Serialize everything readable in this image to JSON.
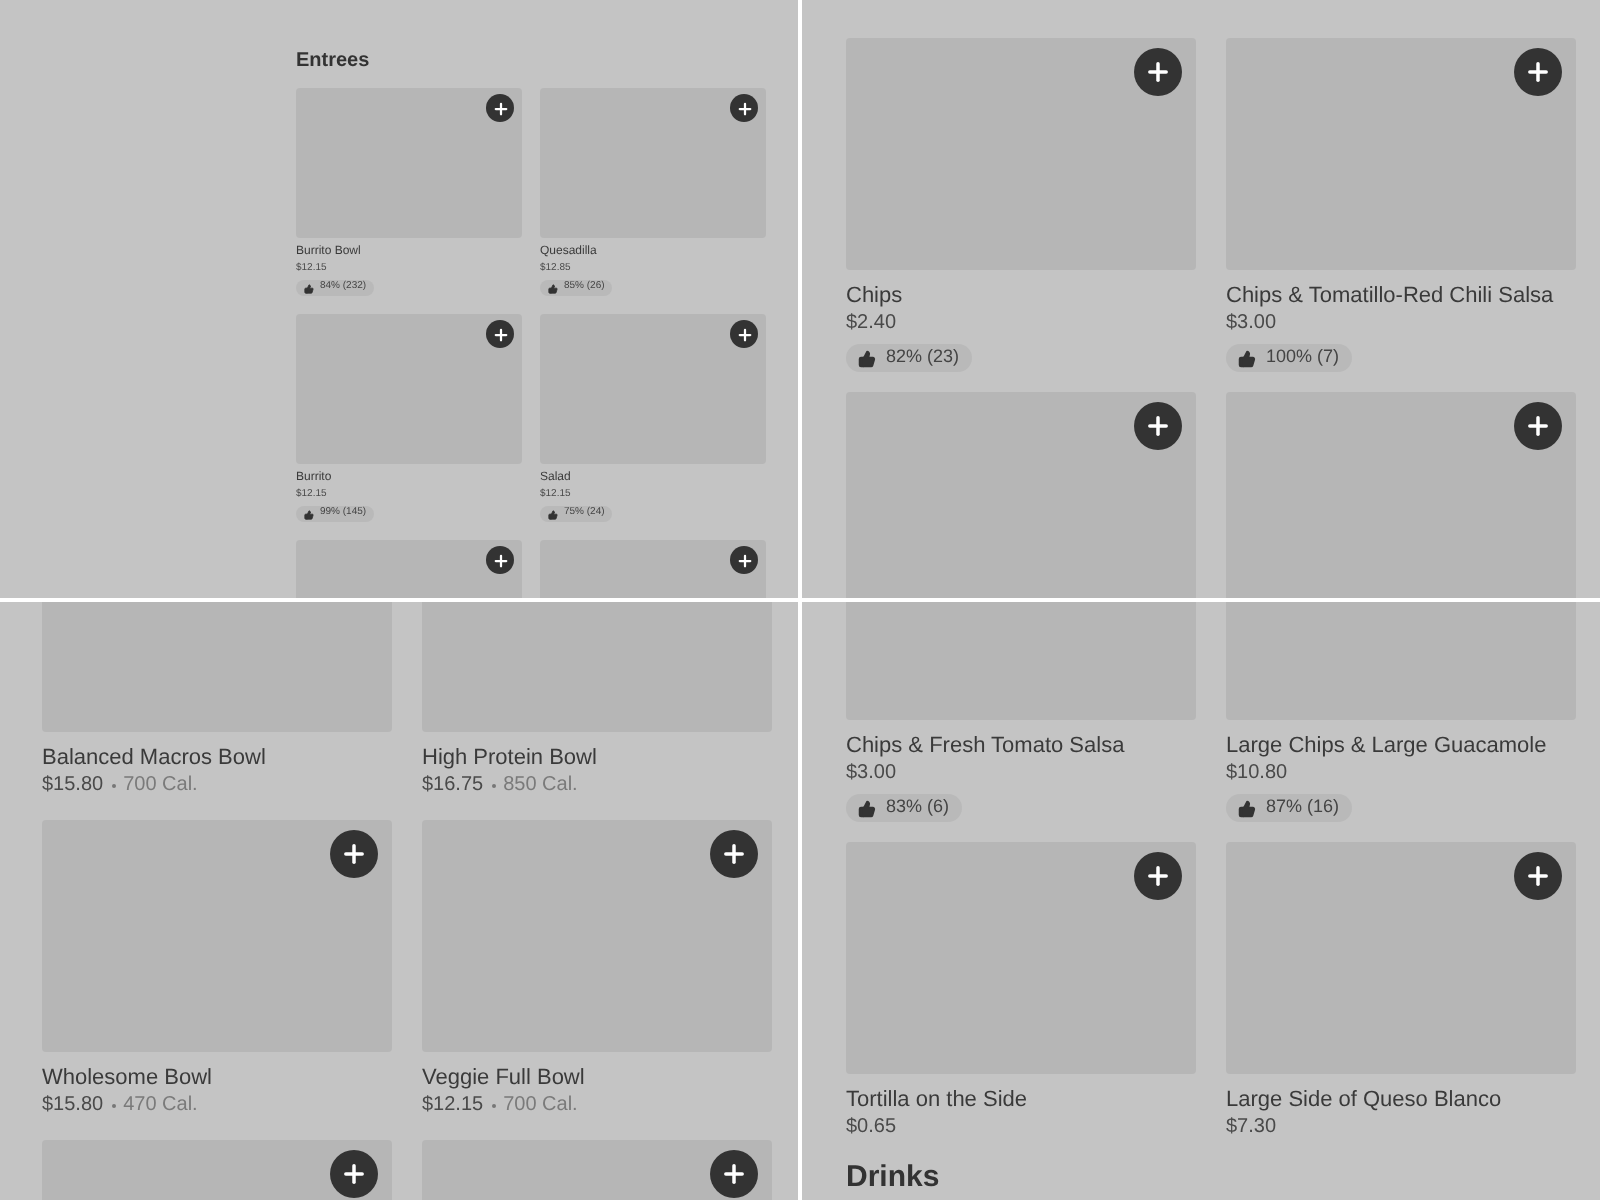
{
  "panels": [
    {
      "heading": "Entrees",
      "items": [
        {
          "kind": "card",
          "name": "Burrito Bowl",
          "price": "$12.15",
          "rating": "84% (232)"
        },
        {
          "kind": "card",
          "name": "Quesadilla",
          "price": "$12.85",
          "rating": "85% (26)"
        },
        {
          "kind": "card",
          "name": "Burrito",
          "price": "$12.15",
          "rating": "99% (145)"
        },
        {
          "kind": "card",
          "name": "Salad",
          "price": "$12.15",
          "rating": "75% (24)"
        },
        {
          "kind": "partial"
        },
        {
          "kind": "partial"
        }
      ]
    },
    {
      "items": [
        {
          "kind": "card",
          "name": "Chips",
          "price": "$2.40",
          "rating": "82% (23)"
        },
        {
          "kind": "card",
          "name": "Chips & Tomatillo-Red Chili Salsa",
          "price": "$3.00",
          "rating": "100% (7)"
        },
        {
          "kind": "partial"
        },
        {
          "kind": "partial"
        }
      ]
    },
    {
      "items": [
        {
          "kind": "card",
          "name": "Balanced Macros Bowl",
          "price": "$15.80",
          "calories": "700 Cal."
        },
        {
          "kind": "card",
          "name": "High Protein Bowl",
          "price": "$16.75",
          "calories": "850 Cal."
        },
        {
          "kind": "card",
          "name": "Wholesome Bowl",
          "price": "$15.80",
          "calories": "470 Cal."
        },
        {
          "kind": "card",
          "name": "Veggie Full Bowl",
          "price": "$12.15",
          "calories": "700 Cal."
        },
        {
          "kind": "partial"
        },
        {
          "kind": "partial"
        }
      ]
    },
    {
      "items": [
        {
          "kind": "card",
          "name": "Chips & Fresh Tomato Salsa",
          "price": "$3.00",
          "rating": "83% (6)"
        },
        {
          "kind": "card",
          "name": "Large Chips & Large Guacamole",
          "price": "$10.80",
          "rating": "87% (16)"
        },
        {
          "kind": "card",
          "name": "Tortilla on the Side",
          "price": "$0.65"
        },
        {
          "kind": "card",
          "name": "Large Side of Queso Blanco",
          "price": "$7.30"
        }
      ],
      "footer_heading": "Drinks"
    }
  ]
}
